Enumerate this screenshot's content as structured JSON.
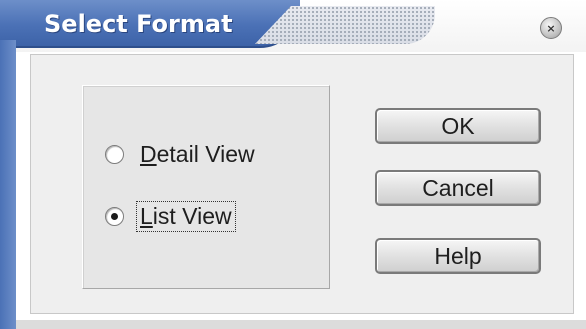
{
  "window": {
    "title": "Select Format",
    "close_glyph": "×",
    "accent_color": "#4b71b6"
  },
  "view_options": {
    "items": [
      {
        "id": "detail",
        "label": "Detail View",
        "mnemonic": "D",
        "rest": "etail View",
        "selected": false
      },
      {
        "id": "list",
        "label": "List View",
        "mnemonic": "L",
        "rest": "ist View",
        "selected": true
      }
    ]
  },
  "buttons": {
    "ok": "OK",
    "cancel": "Cancel",
    "help": "Help"
  }
}
